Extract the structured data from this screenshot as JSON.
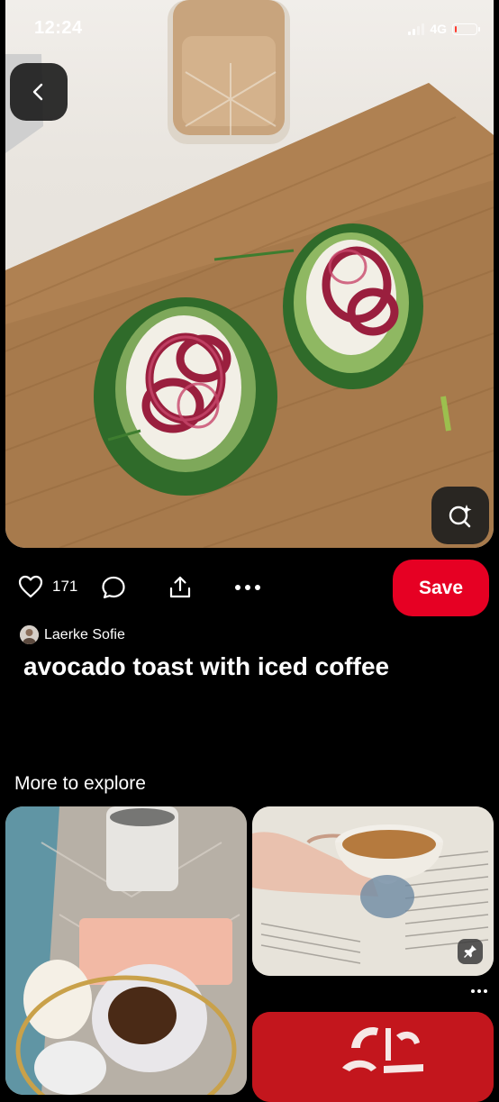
{
  "status_bar": {
    "time": "12:24",
    "network": "4G",
    "battery_level": 0.1
  },
  "hero": {
    "back_icon": "chevron-left-icon",
    "visual_search_icon": "lens-search-icon"
  },
  "actions": {
    "like_icon": "heart-icon",
    "like_count": "171",
    "comment_icon": "comment-icon",
    "share_icon": "share-icon",
    "more_icon": "more-dots-icon",
    "save_label": "Save"
  },
  "pin": {
    "author": "Laerke Sofie",
    "title": "avocado toast with iced coffee"
  },
  "explore": {
    "section_title": "More to explore",
    "cards": [
      {
        "subject": "coffee pour-over with ground coffee"
      },
      {
        "subject": "hand holding espresso cup over book"
      },
      {
        "subject": "red poster with arabic lettering"
      }
    ],
    "card_more_icon": "more-dots-icon",
    "pin_badge_icon": "pin-icon"
  },
  "colors": {
    "save_red": "#e60023",
    "background": "#000000",
    "text": "#ffffff"
  }
}
